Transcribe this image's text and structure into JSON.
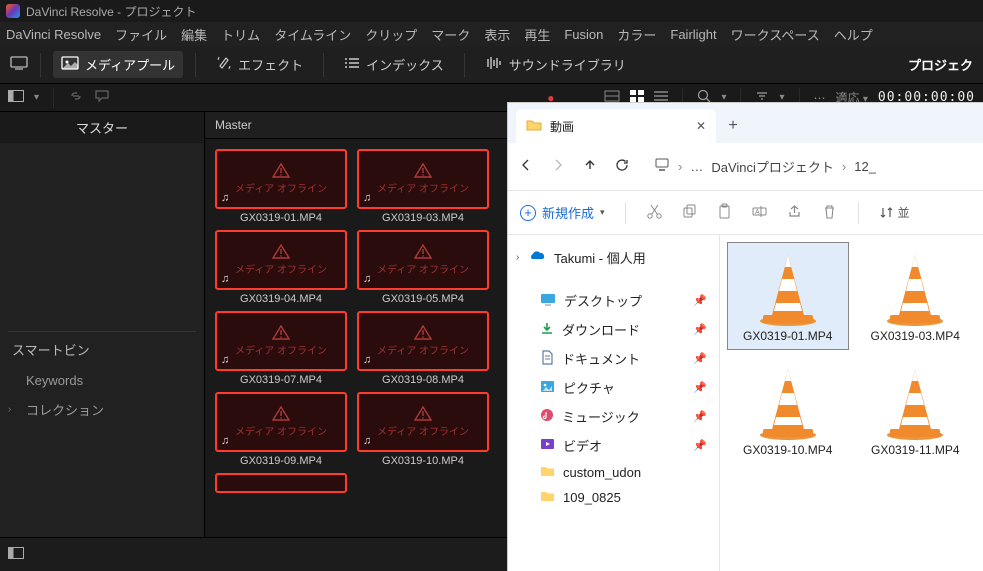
{
  "title": "DaVinci Resolve - プロジェクト",
  "menu": [
    "DaVinci Resolve",
    "ファイル",
    "編集",
    "トリム",
    "タイムライン",
    "クリップ",
    "マーク",
    "表示",
    "再生",
    "Fusion",
    "カラー",
    "Fairlight",
    "ワークスペース",
    "ヘルプ"
  ],
  "workspace": {
    "media_pool": "メディアプール",
    "effects": "エフェクト",
    "index": "インデックス",
    "sound_lib": "サウンドライブラリ",
    "project": "プロジェク"
  },
  "secondary": {
    "fit": "適応",
    "timecode": "00:00:00:00"
  },
  "left_panel": {
    "master": "マスター",
    "smartbin": "スマートビン",
    "keywords": "Keywords",
    "collection": "コレクション"
  },
  "media": {
    "header": "Master",
    "offline_text": "メディア オフライン",
    "clips": [
      "GX0319-01.MP4",
      "GX0319-03.MP4",
      "GX0319-04.MP4",
      "GX0319-05.MP4",
      "GX0319-07.MP4",
      "GX0319-08.MP4",
      "GX0319-09.MP4",
      "GX0319-10.MP4"
    ]
  },
  "explorer": {
    "tab_title": "動画",
    "breadcrumb": {
      "folder": "DaVinciプロジェクト",
      "sub": "12_"
    },
    "new_button": "新規作成",
    "sort": "並",
    "sidebar": {
      "onedrive": "Takumi - 個人用",
      "desktop": "デスクトップ",
      "downloads": "ダウンロード",
      "documents": "ドキュメント",
      "pictures": "ピクチャ",
      "music": "ミュージック",
      "videos": "ビデオ",
      "custom1": "custom_udon",
      "custom2": "109_0825"
    },
    "files": [
      "GX0319-01.MP4",
      "GX0319-03.MP4",
      "GX0319-10.MP4",
      "GX0319-11.MP4"
    ]
  }
}
